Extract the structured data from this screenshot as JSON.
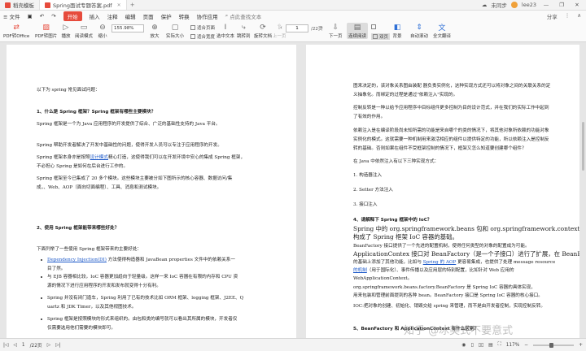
{
  "titlebar": {
    "tabs": [
      {
        "label": "稻壳模板",
        "active": false,
        "color": "#e64b3c"
      },
      {
        "label": "Spring面试专题答案.pdf",
        "active": true,
        "color": "#e64b3c"
      }
    ],
    "add": "+",
    "sync_status": "未同步",
    "user": "lee23",
    "minimize": "—",
    "maximize": "❐",
    "close": "✕"
  },
  "menubar": {
    "file": "≡ 文件",
    "items": [
      "开始",
      "插入",
      "注释",
      "编辑",
      "页面",
      "保护",
      "转换",
      "协作应用"
    ],
    "search_placeholder": "点此查找文本",
    "right": [
      "分享",
      "⋮",
      "∧"
    ]
  },
  "toolbar": {
    "pdf_to_office": "PDF转Office",
    "pdf_to_image": "PDF转图片",
    "play": "播放",
    "read_mode": "阅读模式",
    "zoom_out": "缩小",
    "zoom_value": "155.98%",
    "zoom_in": "放大",
    "actual_size": "实际大小",
    "fit_page": "适合页面",
    "fit_width": "适合宽度",
    "rotate_doc": "旋转文档",
    "previous": "上一页",
    "jump": "跳转到",
    "first": "首页",
    "page_value": "1",
    "page_total": "/22页",
    "last": "尾页",
    "next": "下一页",
    "continuous": "连续阅读",
    "double": "双页",
    "background": "背景",
    "auto_scroll": "自动滚动",
    "full_translate": "全文翻译",
    "ordered_text": "选中文本"
  },
  "left_page": [
    {
      "text": "以下为 spring 常见面试问题："
    },
    {
      "text": "1、什么是 Spring 框架？Spring 框架有哪些主要模块？"
    },
    {
      "text": "Spring 框架是一个为 Java 应用程序的开发提供了综合、广泛的基础性支持的 Java 平台。"
    },
    {
      "text": "Spring 帮助开发者解决了开发中基础性的问题，使得开发人员可以专注于应用程序的开发。"
    },
    {
      "pre": "Spring 框架本身亦是按照",
      "link": "设计模式",
      "post": "精心打造，这使得我们可以在开发环境中安心的集成 Spring 框架，"
    },
    {
      "text": "不必担心 Spring 是如何在后台进行工作的。"
    },
    {
      "text": "Spring 框架至今已集成了 20 多个模块。这些模块主要被分如下图所示的核心容器、数据访问/集"
    },
    {
      "text": "成，、Web、AOP（面向切面编程）、工具、消息和测试模块。"
    },
    {
      "text": "2、使用 Spring 框架能带来哪些好处？"
    },
    {
      "text": "下面列举了一些使用 Spring 框架带来的主要好处："
    },
    {
      "link": "Dependency Injection(DI)",
      "post": " 方法使得构造器和 JavaBean properties 文件中的依赖关系一"
    },
    {
      "text": "目了然。"
    },
    {
      "text": "与 EJB 容器相比较，IoC 容器更加趋向于轻量级。这样一来 IoC 容器在有限的内存和 CPU 资"
    },
    {
      "text": "源的情况下进行应用程序的开发和发布就变得十分有利。"
    },
    {
      "text": "Spring 并没有闭门造车，Spring 利用了已有的技术比如 ORM 框架、logging 框架、J2EE、Q"
    },
    {
      "text": "uartz 和 JDK Timer，以及其他视图技术。"
    },
    {
      "text": "Spring 框架是按照模块的形式来组织的。由包和类的编号就可以看出其所属的模块，开发者仅"
    },
    {
      "text": "仅需要选用他们需要的模块即可。"
    }
  ],
  "right_page": [
    {
      "text": "图来决定的，该对象关系图由装配 器负责实例化，这种实现方式还可以将对象之间的关联关系的定"
    },
    {
      "text": "义抽象化。而绑定的过程是通过\"依赖注入\"实现的。"
    },
    {
      "text": "控制反转是一种以给予应用程序中目标组件更多控制为目的设计范式，并在我们的实际工作中起到"
    },
    {
      "text": "了有效的作用。"
    },
    {
      "text": "依赖注入是在编译阶段尚未知所需的功能是来自哪个的类的情况下，将其他对象所依赖的功能对象"
    },
    {
      "text": "实例化的模式。这就需要一种机制用来激活相应的组件以提供特定的功能，所以依赖注入是控制反"
    },
    {
      "text": "转的基础。否则如果在组件不受框架控制的情况下，框架又怎么知道要创建哪个组件？"
    },
    {
      "text": "在 Java 中依然注入有以下三种实现方式："
    },
    {
      "text": "1.    构造器注入"
    },
    {
      "text": "2.    Setter 方法注入"
    },
    {
      "text": "3.    接口注入"
    },
    {
      "text": "4、请解释下 Spring 框架中的 IoC？"
    },
    {
      "text": "Spring 中的 org.springframework.beans 包和 org.springframework.context 包"
    },
    {
      "text": "构成了 Spring 框架 IoC 容器的基础。"
    },
    {
      "text": "BeanFactory 接口提供了一个先进的配置机制，使得任何类型的对象的配置成为可能。"
    },
    {
      "text": "ApplicationContex 接口对 BeanFactory（是一个子接口）进行了扩展，在 BeanFactory"
    },
    {
      "pre": "的基础上添加了其他功能，比如与 ",
      "link": "Spring 的 AOP",
      "post": " 更容易集成，也提供了处理 message resource"
    },
    {
      "pre": "",
      "link": "的机制",
      "post": "（用于国际化）、事件传播以及应用层的特别配置，比如针对 Web 应用的"
    },
    {
      "text": "WebApplicationContext。"
    },
    {
      "text": "org.springframework.beans.factory.BeanFactory 是 Spring IoC 容器的具体实现，"
    },
    {
      "text": "用来包装和管理前面提到的各种 bean。BeanFactory 接口是 Spring IoC 容器的核心接口。"
    },
    {
      "text": "IOC:把对象的创建、初始化、销毁交给 spring 来管理，而不是由开发者控制，实现控制反转。"
    },
    {
      "text": "5、BeanFactory 和 ApplicationContext 有什么区别？"
    }
  ],
  "watermark": {
    "text": "知乎 @冰美式不要意式"
  },
  "statusbar": {
    "nav_first": "|◁",
    "nav_prev": "◁",
    "page": "1",
    "total": "/22页",
    "nav_next": "▷",
    "nav_last": "▷|",
    "zoom": "117%",
    "minus": "−",
    "plus": "+"
  }
}
